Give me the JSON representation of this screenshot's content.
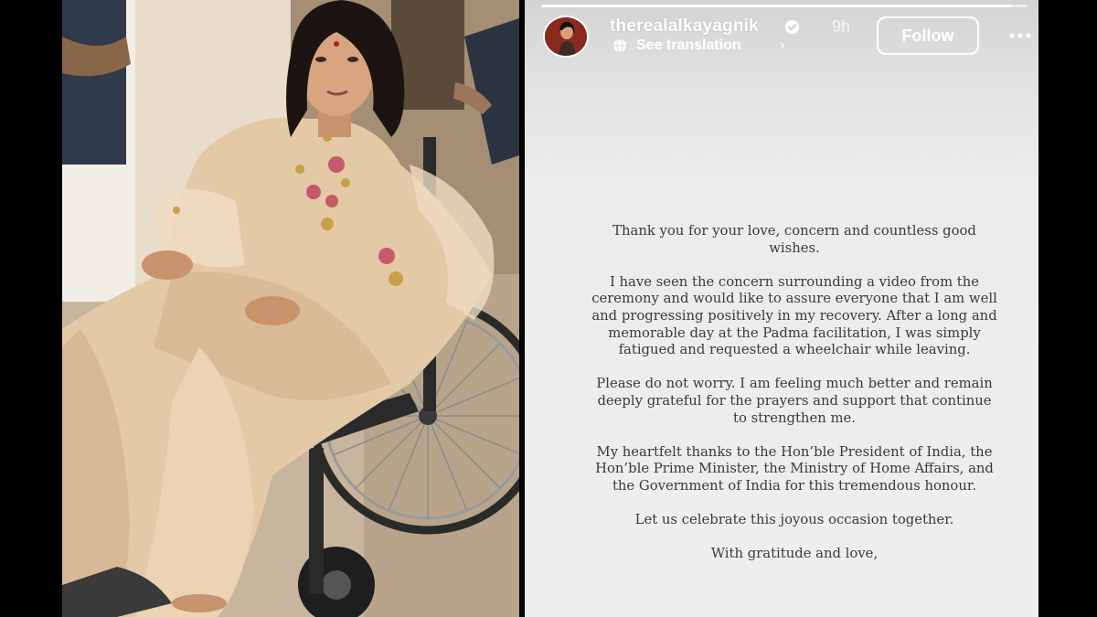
{
  "story": {
    "username": "therealalkayagnik",
    "time_ago": "9h",
    "translate_label": "See translation",
    "translate_chevron": "›",
    "follow_label": "Follow",
    "progress": 0.97,
    "icons": {
      "verified": "verified-badge-icon",
      "globe": "globe-icon",
      "more": "more-options-icon"
    },
    "message": [
      "Thank you for your love, concern and countless good wishes.",
      "I have seen the concern surrounding a video from the ceremony and would like to assure everyone that I am well and progressing positively in my recovery. After a long and memorable day at the Padma facilitation, I was simply fatigued and requested a wheelchair while leaving.",
      "Please do not worry. I am feeling much better and remain deeply grateful for the prayers and support that continue to strengthen me.",
      "My heartfelt thanks to the Hon’ble President of India, the Hon’ble Prime Minister, the Ministry of Home Affairs, and the Government of India for this tremendous honour.",
      "Let us celebrate this joyous occasion together.",
      "With gratitude and love,"
    ]
  },
  "colors": {
    "story_background": "#eeeeee",
    "message_text": "#3a3a3a",
    "overlay_text": "#ffffff",
    "outer_background": "#000000"
  }
}
